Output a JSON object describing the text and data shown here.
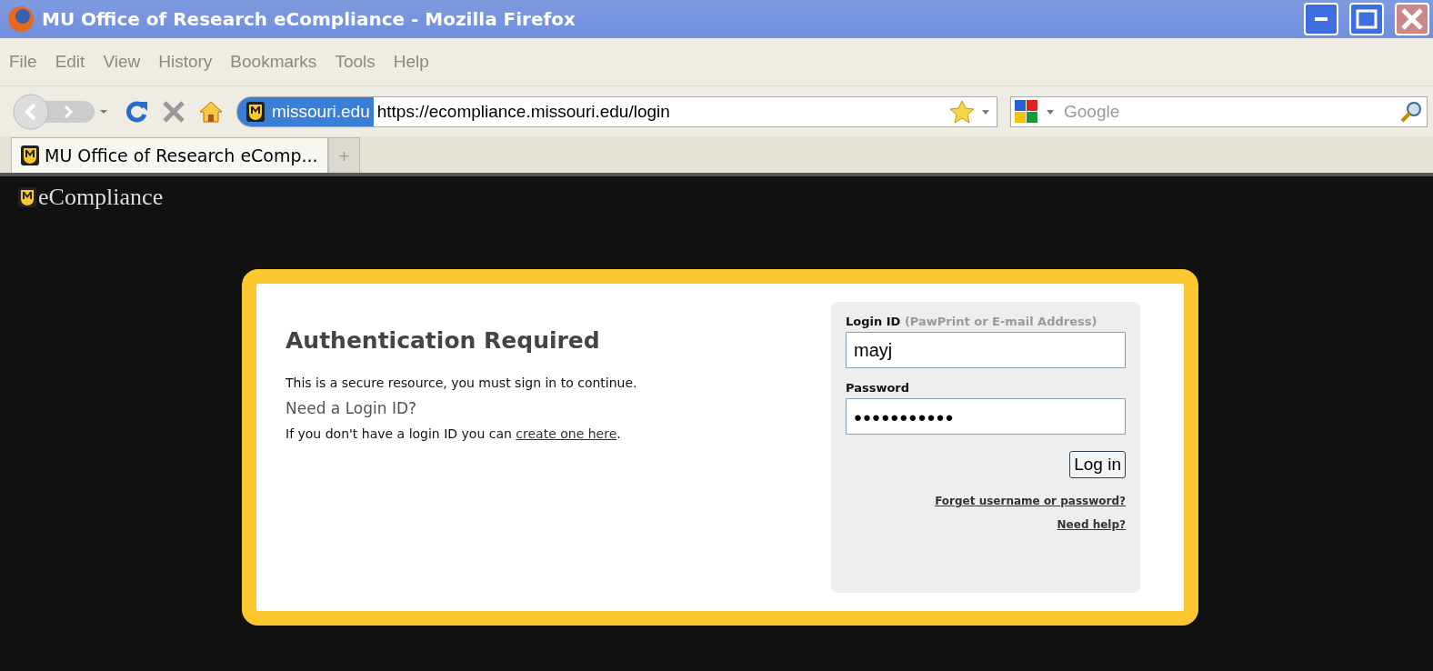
{
  "window": {
    "title": "MU Office of Research eCompliance - Mozilla Firefox"
  },
  "menu": [
    "File",
    "Edit",
    "View",
    "History",
    "Bookmarks",
    "Tools",
    "Help"
  ],
  "address_bar": {
    "site": "missouri.edu",
    "url": "https://ecompliance.missouri.edu/login"
  },
  "search": {
    "placeholder": "Google"
  },
  "tabs": [
    {
      "label": "MU Office of Research eComp...",
      "selected": true
    },
    {
      "label": "+",
      "selected": false
    }
  ],
  "page": {
    "logo": "eCompliance",
    "heading": "Authentication Required",
    "intro": "This is a secure resource, you must sign in to continue.",
    "subheading": "Need a Login ID?",
    "signup_text": "If you don't have a login ID you can ",
    "signup_link": "create one here",
    "signup_end": ".",
    "login_label": "Login ID",
    "login_hint": "(PawPrint or E-mail Address)",
    "login_value": "mayj",
    "password_label": "Password",
    "password_value": "●●●●●●●●●●●",
    "button": "Log in",
    "links": [
      "Forget username or password?",
      "Need help?"
    ]
  }
}
